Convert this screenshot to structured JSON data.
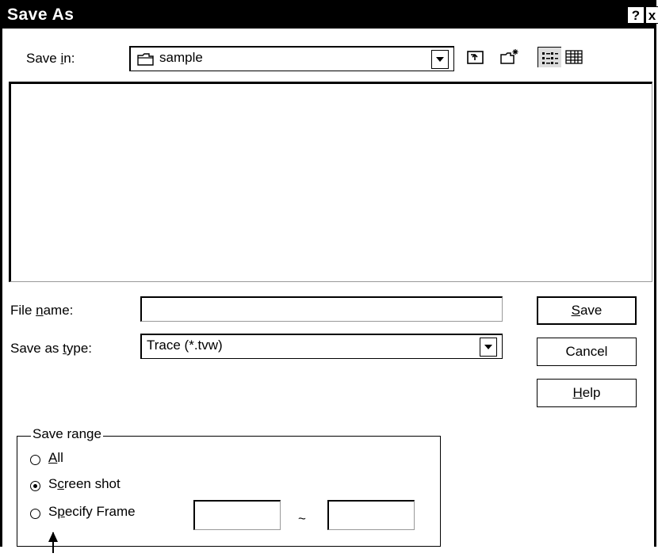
{
  "window": {
    "title": "Save As",
    "help_btn": "?",
    "close_btn": "x"
  },
  "savein": {
    "label_pre": "Save ",
    "label_u": "i",
    "label_post": "n:",
    "value": "sample"
  },
  "filename": {
    "label_pre": "File ",
    "label_u": "n",
    "label_post": "ame:",
    "value": ""
  },
  "savetype": {
    "label_pre": "Save as ",
    "label_u": "t",
    "label_post": "ype:",
    "value": "Trace (*.tvw)"
  },
  "buttons": {
    "save_u": "S",
    "save_rest": "ave",
    "cancel": "Cancel",
    "help_u": "H",
    "help_rest": "elp"
  },
  "save_range": {
    "title": "Save range",
    "all_u": "A",
    "all_rest": "ll",
    "screen_pre": "S",
    "screen_u": "c",
    "screen_post": "reen shot",
    "specify_pre": "S",
    "specify_u": "p",
    "specify_post": "ecify Frame",
    "tilde": "~",
    "selected": "screen_shot",
    "from_value": "",
    "to_value": ""
  }
}
